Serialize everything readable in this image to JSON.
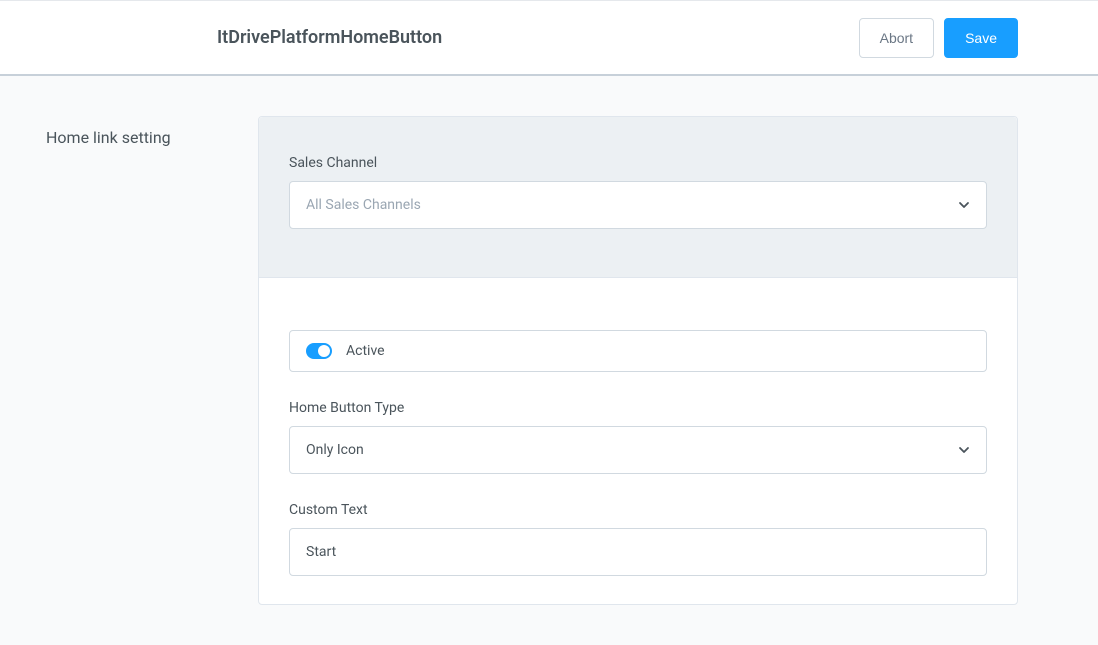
{
  "header": {
    "title": "ItDrivePlatformHomeButton",
    "abort_label": "Abort",
    "save_label": "Save"
  },
  "sidebar": {
    "section_label": "Home link setting"
  },
  "sales_channel": {
    "label": "Sales Channel",
    "placeholder": "All Sales Channels",
    "value": ""
  },
  "active": {
    "label": "Active",
    "value": true
  },
  "home_button_type": {
    "label": "Home Button Type",
    "value": "Only Icon"
  },
  "custom_text": {
    "label": "Custom Text",
    "value": "Start"
  }
}
